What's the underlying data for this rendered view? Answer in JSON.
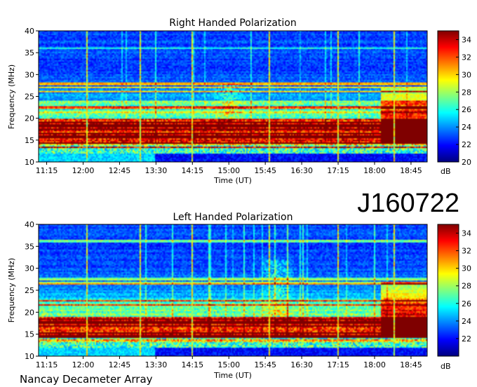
{
  "header": {
    "observation_id": "J160722"
  },
  "footer": {
    "instrument": "Nancay Decameter Array"
  },
  "colors": {
    "background": "#ffffff",
    "axis": "#000000"
  },
  "colormap": {
    "name": "jet",
    "stops": [
      "#00007f",
      "#0000ff",
      "#007fff",
      "#00ffff",
      "#7fff7f",
      "#ffff00",
      "#ff7f00",
      "#ff0000",
      "#7f0000"
    ]
  },
  "chart_data": [
    {
      "type": "heatmap",
      "id": "right",
      "title": "Right Handed Polarization",
      "xlabel": "Time (UT)",
      "ylabel": "Frequency (MHz)",
      "ylim": [
        10,
        40
      ],
      "xlim": [
        "11:05",
        "19:05"
      ],
      "x_ticks": [
        "11:15",
        "12:00",
        "12:45",
        "13:30",
        "14:15",
        "15:00",
        "15:45",
        "16:30",
        "17:15",
        "18:00",
        "18:45"
      ],
      "y_ticks": [
        10,
        15,
        20,
        25,
        30,
        35,
        40
      ],
      "colorbar": {
        "label": "dB",
        "range": [
          20,
          35
        ],
        "ticks": [
          20,
          22,
          24,
          26,
          28,
          30,
          32,
          34
        ]
      },
      "features": {
        "strong_band_mhz": [
          14,
          20
        ],
        "moderate_band_mhz": [
          20,
          24
        ],
        "burst_time": "15:00",
        "burst_freq_mhz": [
          19,
          28
        ],
        "interference_lines_mhz": [
          13.4,
          14.2,
          15.8,
          16.6,
          17.5,
          18.3,
          19.1,
          21.4,
          22.5,
          26.2,
          27.1,
          27.9,
          36.1
        ],
        "vertical_markers": [
          "12:05",
          "13:10",
          "14:15",
          "15:50",
          "17:15",
          "18:25"
        ]
      }
    },
    {
      "type": "heatmap",
      "id": "left",
      "title": "Left Handed Polarization",
      "xlabel": "Time (UT)",
      "ylabel": "Frequency (MHz)",
      "ylim": [
        10,
        40
      ],
      "xlim": [
        "11:05",
        "19:05"
      ],
      "x_ticks": [
        "11:15",
        "12:00",
        "12:45",
        "13:30",
        "14:15",
        "15:00",
        "15:45",
        "16:30",
        "17:15",
        "18:00",
        "18:45"
      ],
      "y_ticks": [
        10,
        15,
        20,
        25,
        30,
        35,
        40
      ],
      "colorbar": {
        "label": "dB",
        "range": [
          20,
          35
        ],
        "ticks": [
          22,
          24,
          26,
          28,
          30,
          32,
          34
        ]
      },
      "features": {
        "strong_band_mhz": [
          14,
          19
        ],
        "moderate_band_mhz": [
          19,
          23
        ],
        "burst_time": "16:00",
        "burst_freq_mhz": [
          18,
          32
        ],
        "interference_lines_mhz": [
          13.5,
          14.5,
          15.3,
          16.8,
          17.7,
          18.5,
          21.6,
          22.6,
          26.6,
          27.6,
          36.2
        ],
        "vertical_markers": [
          "12:05",
          "13:10",
          "14:15",
          "15:50",
          "17:15",
          "18:25"
        ]
      }
    }
  ]
}
